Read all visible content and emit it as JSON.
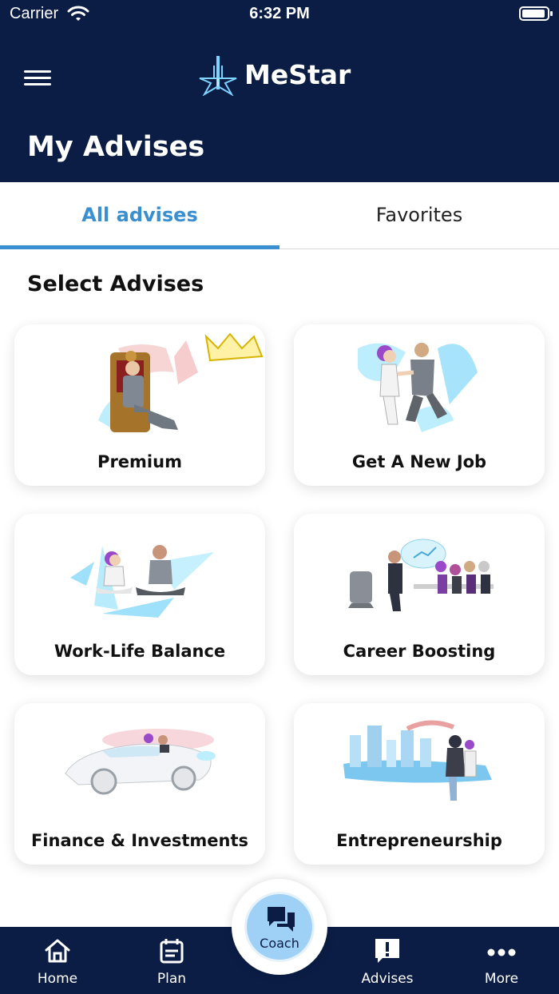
{
  "status_bar": {
    "carrier": "Carrier",
    "time": "6:32 PM"
  },
  "header": {
    "app_name": "MeStar",
    "page_title": "My Advises"
  },
  "tabs": [
    {
      "label": "All advises",
      "active": true
    },
    {
      "label": "Favorites",
      "active": false
    }
  ],
  "section_title": "Select Advises",
  "cards": [
    {
      "label": "Premium",
      "icon": "king-on-throne-illustration"
    },
    {
      "label": "Get A New Job",
      "icon": "handshake-illustration"
    },
    {
      "label": "Work-Life Balance",
      "icon": "meditation-illustration"
    },
    {
      "label": "Career Boosting",
      "icon": "meeting-illustration"
    },
    {
      "label": "Finance & Investments",
      "icon": "sports-car-illustration"
    },
    {
      "label": "Entrepreneurship",
      "icon": "city-skyline-illustration"
    }
  ],
  "bottom_nav": {
    "home": "Home",
    "plan": "Plan",
    "coach": "Coach",
    "advises": "Advises",
    "more": "More"
  },
  "colors": {
    "navy": "#0b1d45",
    "accent": "#3a8fd1",
    "coach_bg": "#9fd0f6"
  }
}
